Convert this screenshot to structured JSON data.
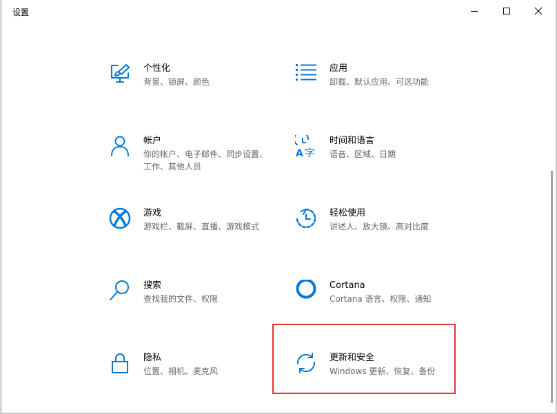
{
  "window": {
    "title": "设置",
    "controls": {
      "minimize_icon": "minimize-icon",
      "maximize_icon": "maximize-icon",
      "close_icon": "close-icon"
    }
  },
  "accent_color": "#0078d7",
  "highlight_color": "#e53333",
  "tiles": [
    {
      "name": "个性化",
      "desc": "背景、锁屏、颜色",
      "icon": "personalization-icon"
    },
    {
      "name": "应用",
      "desc": "卸载、默认应用、可选功能",
      "icon": "apps-icon"
    },
    {
      "name": "帐户",
      "desc": "你的帐户、电子邮件、同步设置、工作、其他人员",
      "icon": "account-icon"
    },
    {
      "name": "时间和语言",
      "desc": "语音、区域、日期",
      "icon": "time-language-icon"
    },
    {
      "name": "游戏",
      "desc": "游戏栏、截屏、直播、游戏模式",
      "icon": "xbox-icon"
    },
    {
      "name": "轻松使用",
      "desc": "讲述人、放大镜、高对比度",
      "icon": "ease-of-access-icon"
    },
    {
      "name": "搜索",
      "desc": "查找我的文件、权限",
      "icon": "search-icon"
    },
    {
      "name": "Cortana",
      "desc": "Cortana 语言、权限、通知",
      "icon": "cortana-icon"
    },
    {
      "name": "隐私",
      "desc": "位置、相机、麦克风",
      "icon": "lock-icon"
    },
    {
      "name": "更新和安全",
      "desc": "Windows 更新、恢复、备份",
      "icon": "update-sync-icon"
    }
  ]
}
